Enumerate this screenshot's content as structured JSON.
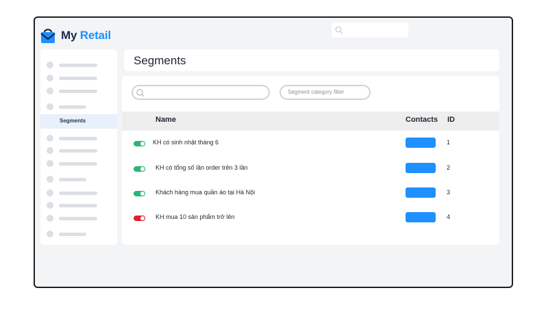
{
  "app": {
    "brand_my": "My",
    "brand_retail": "Retail"
  },
  "colors": {
    "brand": "#1e90ff",
    "toggle_on": "#2bb673",
    "toggle_off": "#e02030",
    "contact_bar": "#1e90ff"
  },
  "sidebar": {
    "active_label": "Segments"
  },
  "page": {
    "title": "Segments"
  },
  "filters": {
    "search_placeholder": "",
    "category_placeholder": "Segment category filter"
  },
  "table": {
    "columns": [
      "Name",
      "Contacts",
      "ID"
    ],
    "rows": [
      {
        "enabled": true,
        "name": "KH có sinh nhật tháng 6",
        "id": "1"
      },
      {
        "enabled": true,
        "name": "KH có tổng số lần order trên 3 lần",
        "id": "2"
      },
      {
        "enabled": true,
        "name": "Khách hàng mua quần áo tại Hà Nội",
        "id": "3"
      },
      {
        "enabled": false,
        "name": "KH mua 10 sản phẩm trở lên",
        "id": "4"
      }
    ]
  }
}
